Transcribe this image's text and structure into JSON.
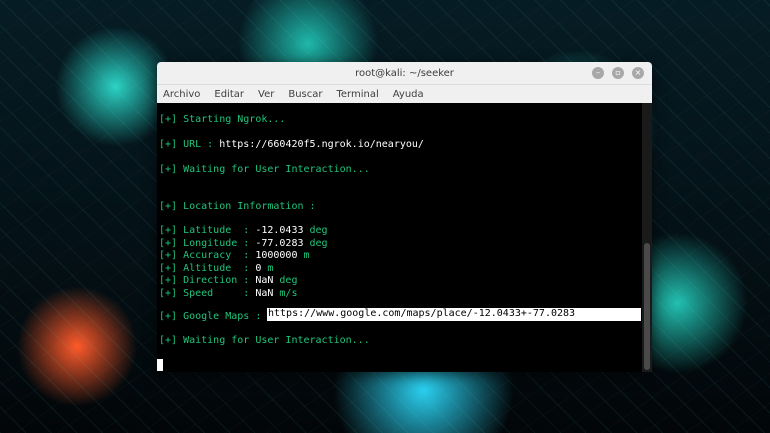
{
  "window": {
    "title": "root@kali: ~/seeker",
    "buttons": [
      "–",
      "▫",
      "×"
    ]
  },
  "menu": [
    "Archivo",
    "Editar",
    "Ver",
    "Buscar",
    "Terminal",
    "Ayuda"
  ],
  "terminal": {
    "l1": "[+] Starting Ngrok...",
    "l2_prefix": "[+] URL : ",
    "l2_url": "https://660420f5.ngrok.io/nearyou/",
    "l3": "[+] Waiting for User Interaction...",
    "l4": "[+] Location Information :",
    "lat_label": "[+] Latitude  : ",
    "lat_value": "-12.0433",
    "lat_unit": " deg",
    "lon_label": "[+] Longitude : ",
    "lon_value": "-77.0283",
    "lon_unit": " deg",
    "acc_label": "[+] Accuracy  : ",
    "acc_value": "1000000",
    "acc_unit": " m",
    "alt_label": "[+] Altitude  : ",
    "alt_value": "0",
    "alt_unit": " m",
    "dir_label": "[+] Direction : ",
    "dir_value": "NaN",
    "dir_unit": " deg",
    "spd_label": "[+] Speed     : ",
    "spd_value": "NaN",
    "spd_unit": " m/s",
    "maps_label": "[+] Google Maps : ",
    "maps_url": "https://www.google.com/maps/place/-12.0433+-77.0283",
    "l_last": "[+] Waiting for User Interaction..."
  }
}
